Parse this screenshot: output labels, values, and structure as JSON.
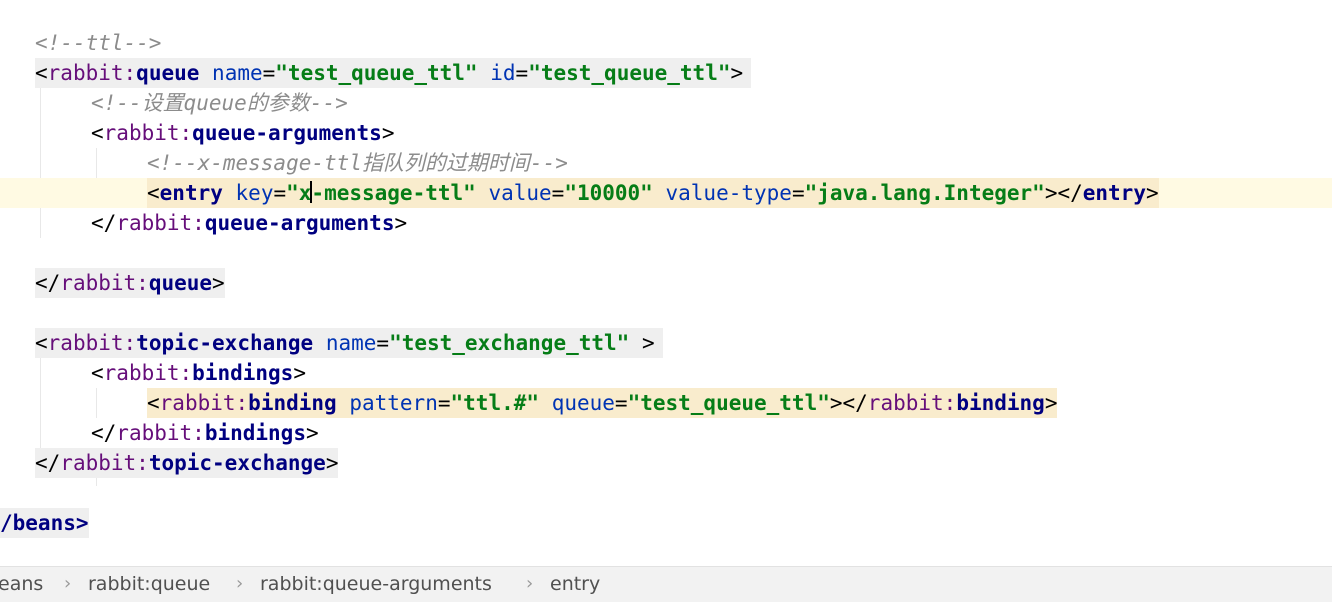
{
  "editor": {
    "comment_ttl": "<!--ttl-->",
    "queue_open_tag": "<rabbit:queue",
    "queue_ns": "rabbit:",
    "queue_tag": "queue",
    "attr_name": "name",
    "val_test_queue_ttl": "\"test_queue_ttl\"",
    "attr_id": "id",
    "comment_set_queue_prefix": "<!--设置",
    "comment_set_queue_word": "queue",
    "comment_set_queue_suffix": "的参数-->",
    "queue_arguments_tag": "queue-arguments",
    "comment_msg_ttl_prefix": "<!--x-message-ttl",
    "comment_msg_ttl_suffix": "指队列的过期时间-->",
    "entry_tag": "entry",
    "attr_key": "key",
    "val_key_a": "\"x",
    "val_key_b": "-message-ttl\"",
    "attr_value": "value",
    "val_value": "\"10000\"",
    "attr_value_type": "value-type",
    "val_value_type": "\"java.lang.Integer\"",
    "topic_exchange_tag": "topic-exchange",
    "val_test_exchange_ttl": "\"test_exchange_ttl\"",
    "bindings_tag": "bindings",
    "binding_tag": "binding",
    "attr_pattern": "pattern",
    "val_pattern": "\"ttl.#\"",
    "attr_queue": "queue",
    "beans_close": "/beans>"
  },
  "breadcrumb": {
    "items": [
      "eans",
      "rabbit:queue",
      "rabbit:queue-arguments",
      "entry"
    ],
    "separator": "›"
  },
  "colors": {
    "tag": "#000080",
    "namespace": "#660e7a",
    "attribute": "#0033b3",
    "value": "#067d17",
    "comment": "#8c8c8c",
    "current_line": "#fffae3",
    "tag_highlight": "#f9eccd"
  }
}
